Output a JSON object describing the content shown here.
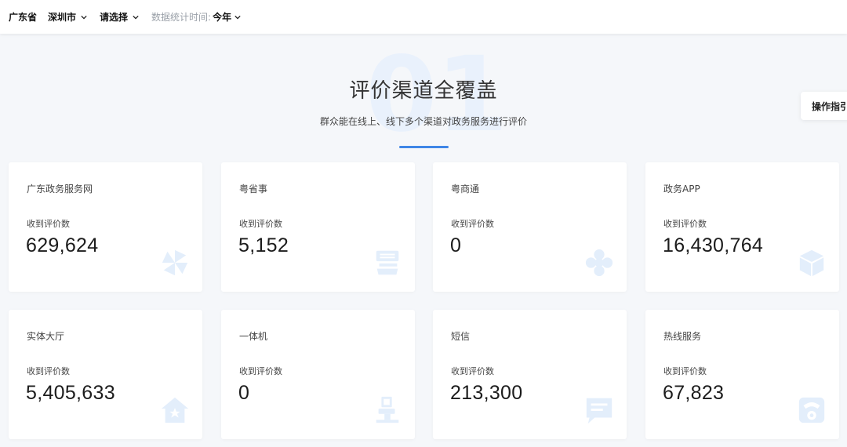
{
  "filters": {
    "province": "广东省",
    "city": "深圳市",
    "district": "请选择",
    "time_label": "数据统计时间:",
    "time_value": "今年"
  },
  "hero": {
    "big_number": "01",
    "title": "评价渠道全覆盖",
    "subtitle": "群众能在线上、线下多个渠道对政务服务进行评价"
  },
  "guide_button": "操作指引",
  "count_caption": "收到评价数",
  "channels": [
    {
      "name": "广东政务服务网",
      "count": "629,624",
      "icon": "pinwheel-icon"
    },
    {
      "name": "粤省事",
      "count": "5,152",
      "icon": "yue-app-icon"
    },
    {
      "name": "粤商通",
      "count": "0",
      "icon": "flower-icon"
    },
    {
      "name": "政务APP",
      "count": "16,430,764",
      "icon": "cube-icon"
    },
    {
      "name": "实体大厅",
      "count": "5,405,633",
      "icon": "house-icon"
    },
    {
      "name": "一体机",
      "count": "0",
      "icon": "kiosk-icon"
    },
    {
      "name": "短信",
      "count": "213,300",
      "icon": "message-icon"
    },
    {
      "name": "热线服务",
      "count": "67,823",
      "icon": "telephone-icon"
    }
  ],
  "colors": {
    "accent": "#3f86e6",
    "icon_tint": "#e3eefb",
    "big_number": "#e9f1fc"
  }
}
